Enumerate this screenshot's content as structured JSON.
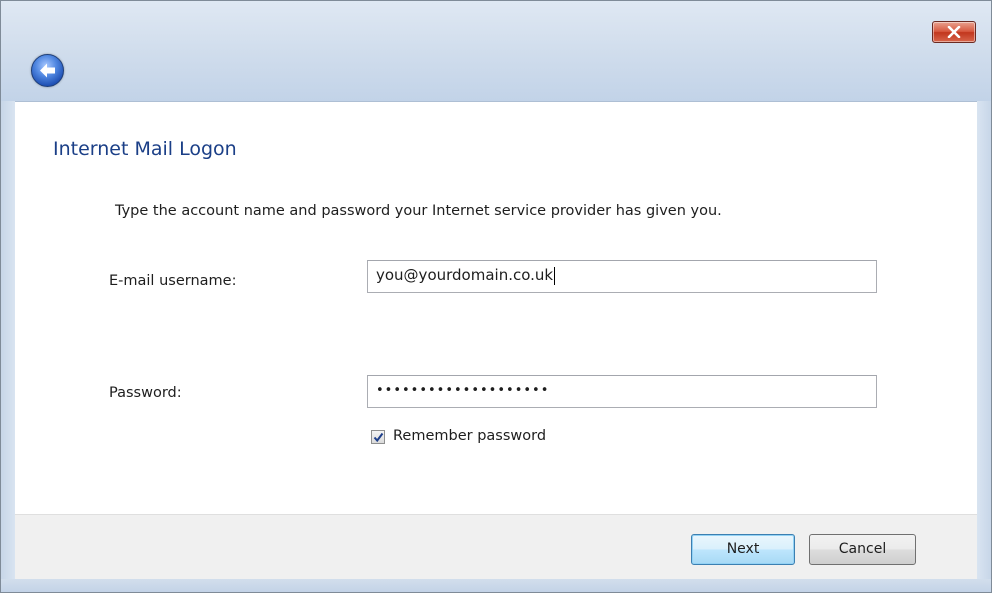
{
  "window": {
    "title": ""
  },
  "titlebar": {
    "close_icon": "close-icon",
    "back_icon": "back-arrow-icon"
  },
  "main": {
    "heading": "Internet Mail Logon",
    "instructions": "Type the account name and password your Internet service provider has given you.",
    "username_label": "E-mail username:",
    "username_value": "you@yourdomain.co.uk",
    "password_label": "Password:",
    "password_value": "••••••••••••••••••••",
    "remember_label": "Remember password",
    "remember_checked": true
  },
  "footer": {
    "next_label": "Next",
    "cancel_label": "Cancel"
  },
  "colors": {
    "heading": "#1b3f87",
    "close_button": "#c1361d",
    "default_button_border": "#3c7fb1"
  }
}
